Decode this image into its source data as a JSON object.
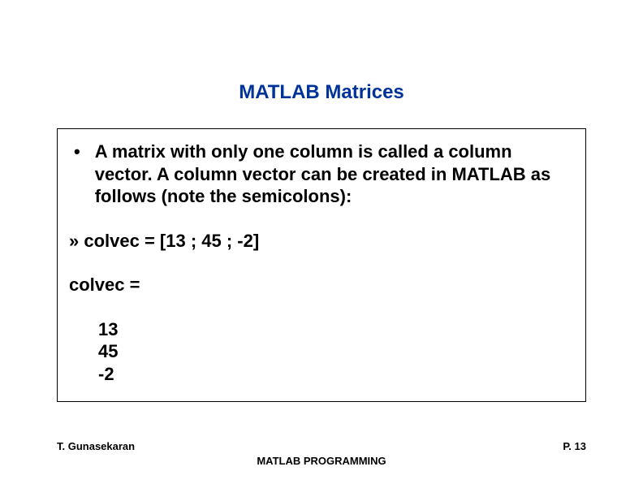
{
  "title": "MATLAB Matrices",
  "bullet": {
    "dot": "•",
    "text": "A matrix with only one column is called a column vector.  A column vector can be created in MATLAB as follows (note the semicolons):"
  },
  "code_line": "» colvec = [13 ; 45 ; -2]",
  "output_label": "colvec =",
  "output_values": [
    "13",
    "45",
    "-2"
  ],
  "footer": {
    "left": "T. Gunasekaran",
    "center": "MATLAB PROGRAMMING",
    "right": "P. 13"
  }
}
